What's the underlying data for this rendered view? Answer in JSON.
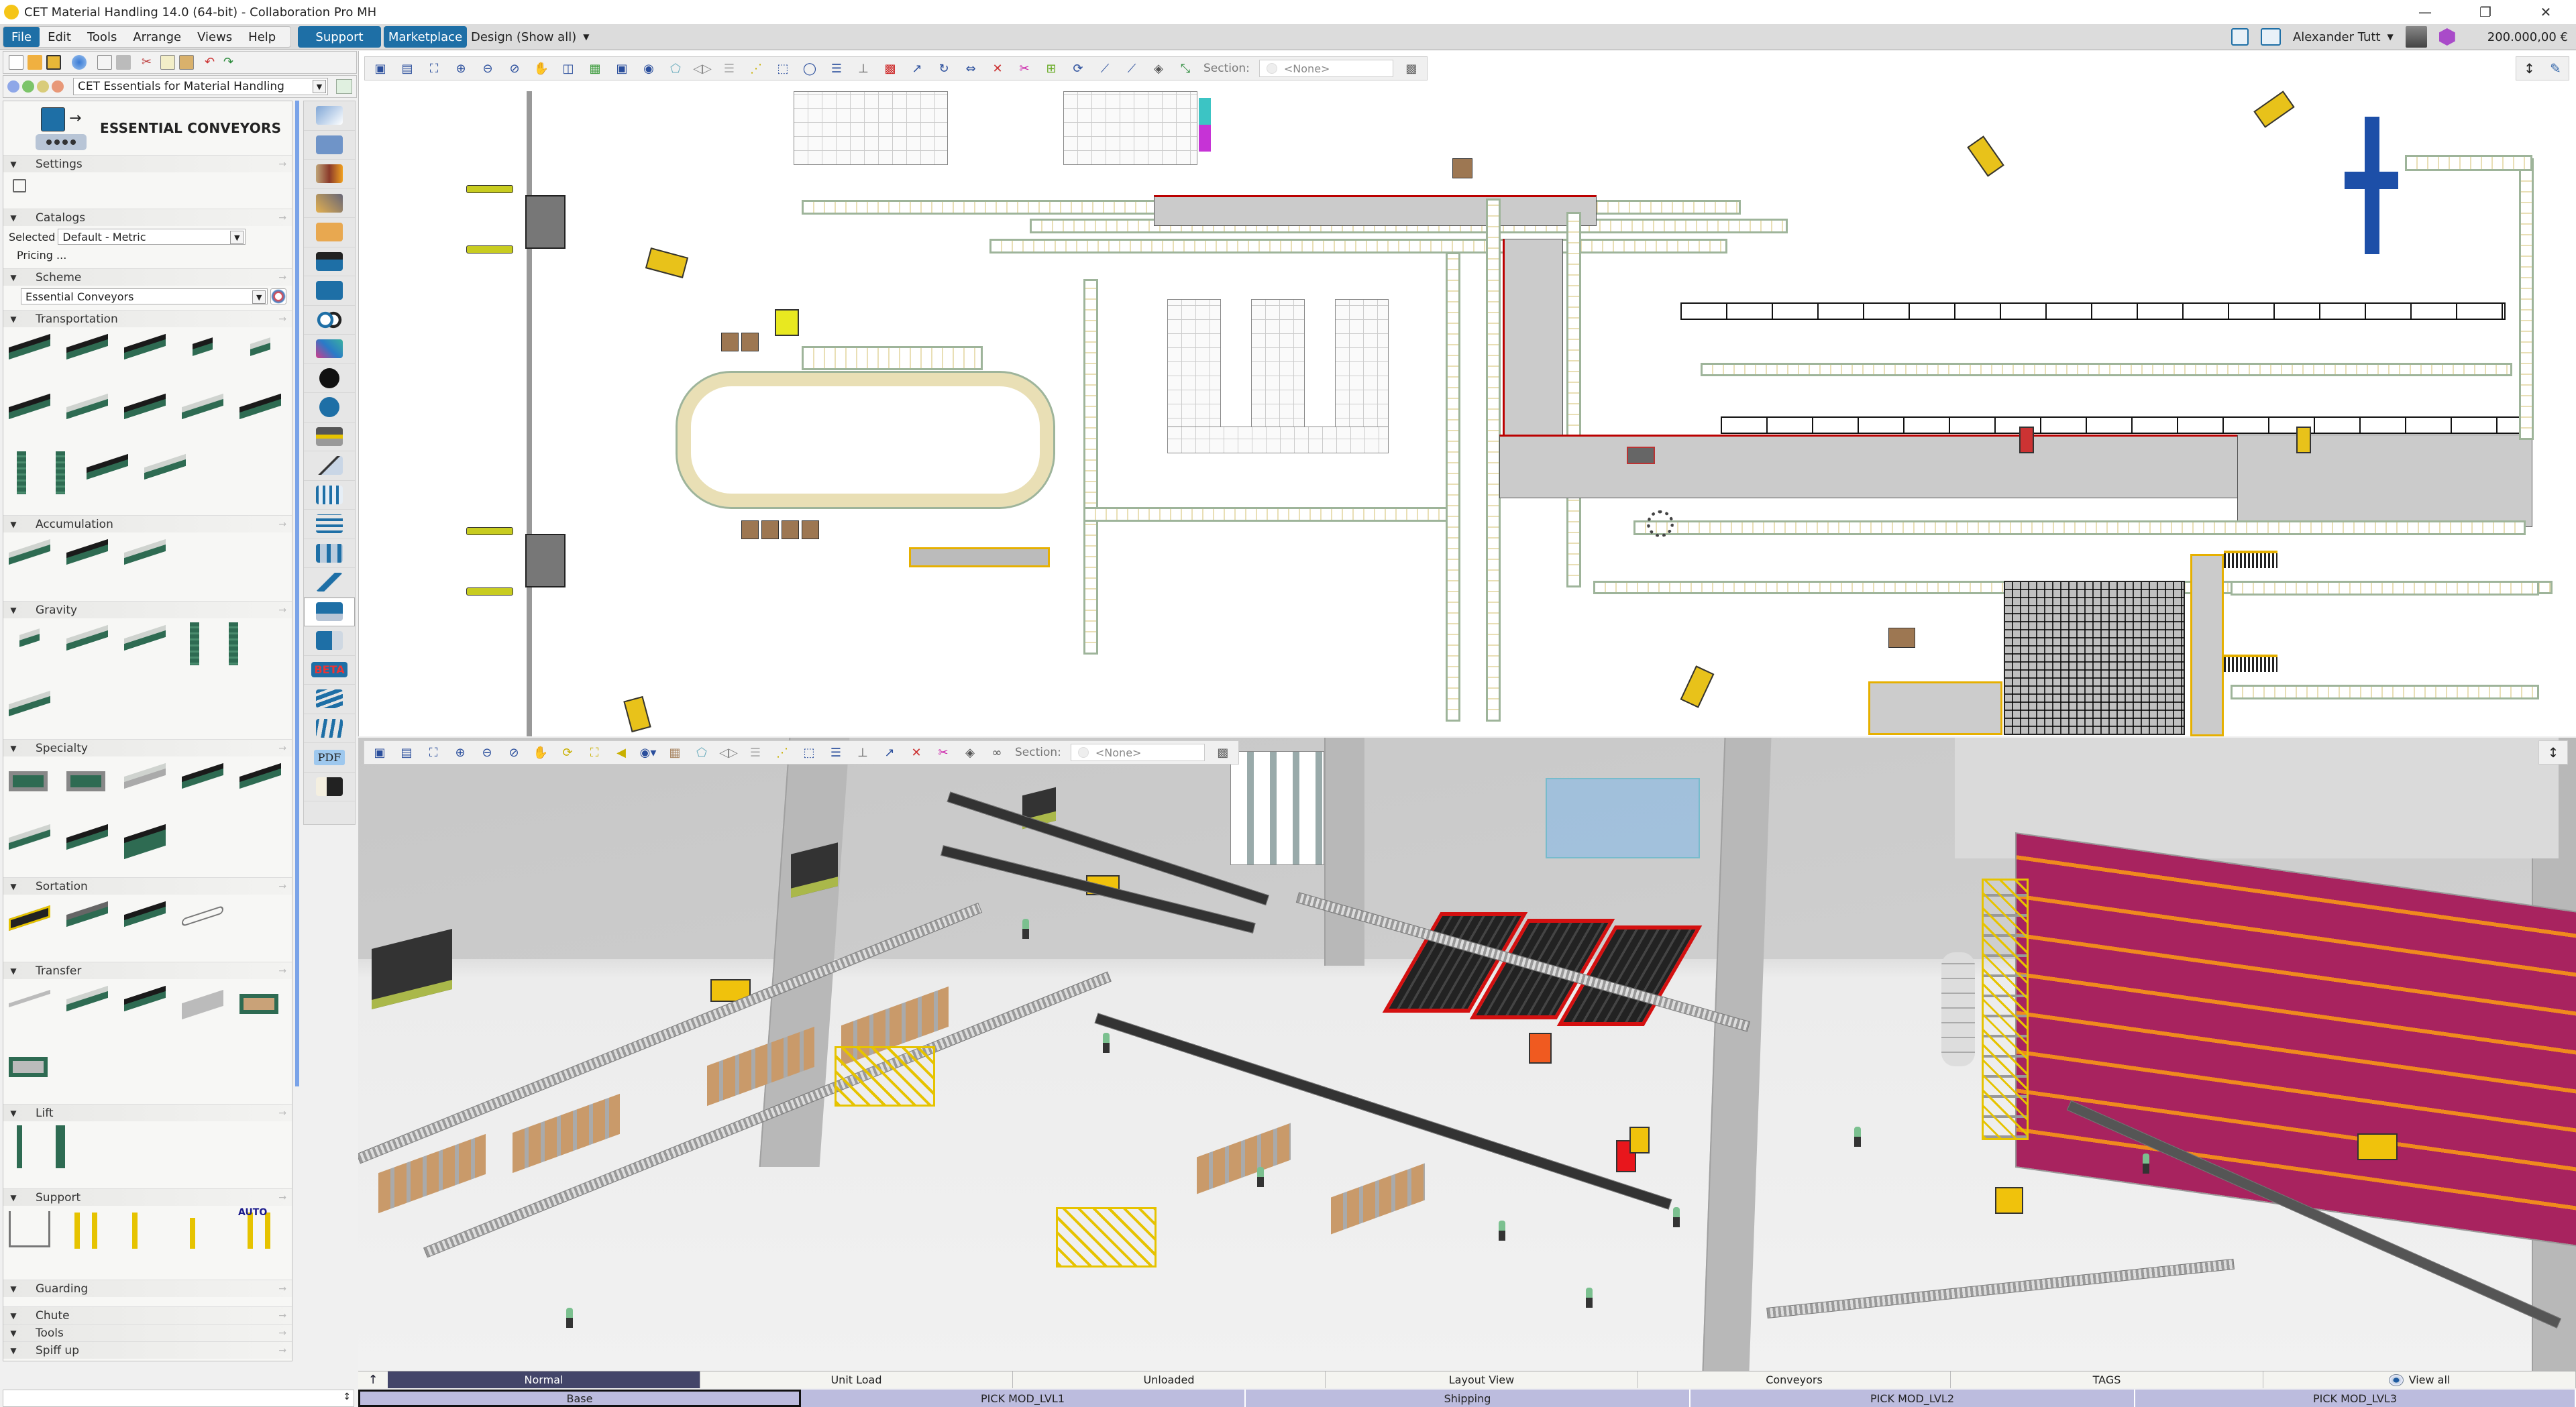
{
  "window": {
    "title": "CET Material Handling 14.0 (64-bit) - Collaboration Pro MH",
    "controls": [
      "minimize",
      "restore",
      "close"
    ]
  },
  "menubar": {
    "items": [
      "File",
      "Edit",
      "Tools",
      "Arrange",
      "Views",
      "Help"
    ],
    "active": "File",
    "support_label": "Support",
    "marketplace_label": "Marketplace",
    "design_dropdown": "Design (Show all)"
  },
  "user": {
    "name": "Alexander Tutt",
    "balance": "200.000,00 €"
  },
  "colors": {
    "accent": "#1e6fa6",
    "active_tab": "#434569",
    "layer_tabs": "#bcbcde",
    "rack_magenta": "#a8235f",
    "rack_orange": "#f08a1e"
  },
  "left_toolbar": {
    "icons": [
      "new-icon",
      "open-icon",
      "save-icon",
      "web-icon",
      "print-preview-icon",
      "print-icon",
      "cut-icon",
      "copy-icon",
      "paste-icon",
      "undo-icon",
      "redo-icon"
    ]
  },
  "catalog_bar": {
    "selected": "CET Essentials for Material Handling"
  },
  "panel": {
    "title": "ESSENTIAL CONVEYORS",
    "sections": [
      {
        "label": "Settings"
      },
      {
        "label": "Catalogs"
      },
      {
        "label": "Scheme"
      },
      {
        "label": "Transportation"
      },
      {
        "label": "Accumulation"
      },
      {
        "label": "Gravity"
      },
      {
        "label": "Specialty"
      },
      {
        "label": "Sortation"
      },
      {
        "label": "Transfer"
      },
      {
        "label": "Lift"
      },
      {
        "label": "Support"
      },
      {
        "label": "Guarding"
      },
      {
        "label": "Chute"
      },
      {
        "label": "Tools"
      },
      {
        "label": "Spiff up"
      }
    ],
    "catalogs_selected_label": "Selected",
    "catalogs_selected_value": "Default - Metric",
    "pricing_label": "Pricing ...",
    "scheme_value": "Essential Conveyors",
    "support_auto_label": "AUTO"
  },
  "extension_icons": [
    "building-icon",
    "block-icon",
    "materials-icon",
    "measure-icon",
    "explorer-icon",
    "pdf-cube-icon",
    "catalog-book-icon",
    "link-rings-icon",
    "interlock-icon",
    "t-logo-icon",
    "sketchup-icon",
    "stand-icon",
    "stairs-icon",
    "racking-icon",
    "shelves-icon",
    "mezzanine-icon",
    "robot-arm-icon",
    "essential-conveyors-icon",
    "beam-icon",
    "beta-icon",
    "steps-icon",
    "lanes-icon",
    "pdf-icon",
    "binoculars-icon"
  ],
  "view2d": {
    "section_label": "Section:",
    "section_value": "<None>"
  },
  "view3d": {
    "section_label": "Section:",
    "section_value": "<None>"
  },
  "view_tabs": {
    "items": [
      "Normal",
      "Unit Load",
      "Unloaded",
      "Layout View",
      "Conveyors",
      "TAGS",
      "View all"
    ],
    "active": "Normal"
  },
  "layer_tabs": {
    "items": [
      "Base",
      "PICK MOD_LVL1",
      "Shipping",
      "PICK MOD_LVL2",
      "PICK MOD_LVL3"
    ],
    "active": "Base"
  }
}
